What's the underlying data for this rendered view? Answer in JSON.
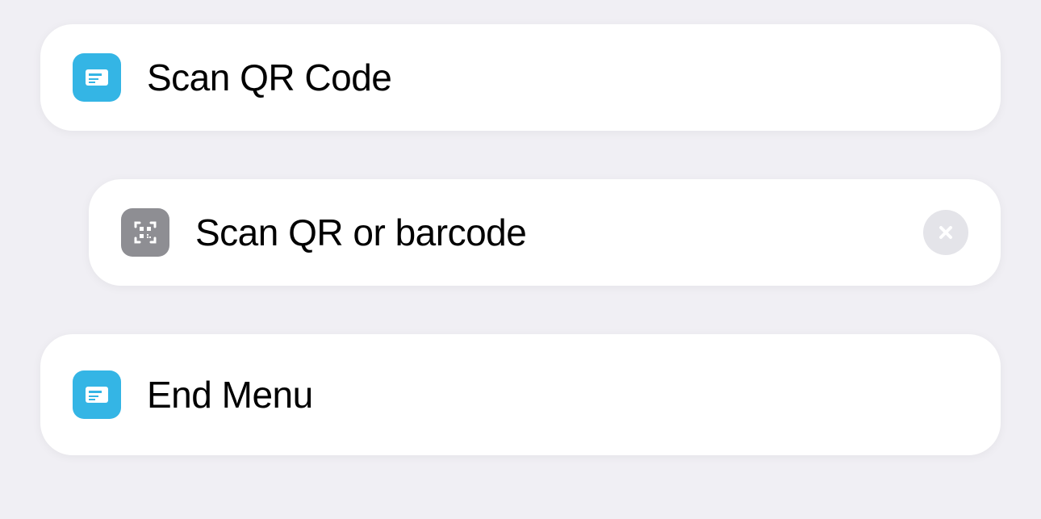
{
  "items": {
    "menu_option_1": {
      "label": "Scan QR Code"
    },
    "action_1": {
      "label": "Scan QR or barcode"
    },
    "menu_end": {
      "label": "End Menu"
    }
  }
}
